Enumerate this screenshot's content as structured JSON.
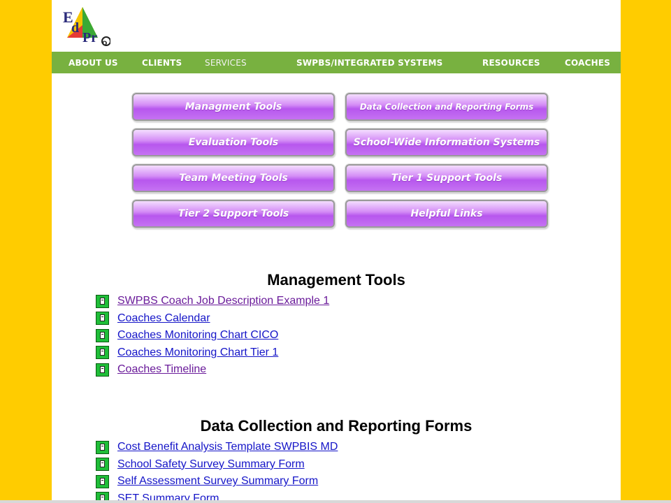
{
  "brand": {
    "logo_letters": [
      "E",
      "d",
      "Pr",
      "o"
    ]
  },
  "nav": {
    "items": [
      {
        "label": "ABOUT US"
      },
      {
        "label": "CLIENTS"
      },
      {
        "label": "SERVICES"
      },
      {
        "label": "SWPBS/INTEGRATED SYSTEMS"
      },
      {
        "label": "RESOURCES"
      },
      {
        "label": "COACHES"
      }
    ],
    "active": "SERVICES"
  },
  "tool_buttons": [
    {
      "label": "Managment Tools"
    },
    {
      "label": "Data Collection and Reporting Forms"
    },
    {
      "label": "Evaluation Tools"
    },
    {
      "label": "School-Wide Information Systems"
    },
    {
      "label": "Team Meeting Tools"
    },
    {
      "label": "Tier 1 Support Tools"
    },
    {
      "label": "Tier 2 Support Tools"
    },
    {
      "label": "Helpful Links"
    }
  ],
  "sections": [
    {
      "title": "Management Tools",
      "links": [
        {
          "text": "SWPBS Coach Job Description Example 1"
        },
        {
          "text": "Coaches Calendar"
        },
        {
          "text": "Coaches Monitoring Chart CICO"
        },
        {
          "text": "Coaches Monitoring Chart Tier 1"
        },
        {
          "text": "Coaches Timeline"
        }
      ]
    },
    {
      "title": "Data Collection and Reporting Forms",
      "links": [
        {
          "text": "Cost Benefit Analysis Template SWPBIS MD"
        },
        {
          "text": "School Safety Survey Summary Form"
        },
        {
          "text": "Self Assessment Survey Summary Form"
        },
        {
          "text": "SET Summary Form"
        }
      ]
    }
  ],
  "colors": {
    "page_background": "#ffcc00",
    "nav_green": "#78b140",
    "button_purple": "#c572f2",
    "link_blue": "#1515c8",
    "doc_icon_green": "#1fbe38"
  }
}
